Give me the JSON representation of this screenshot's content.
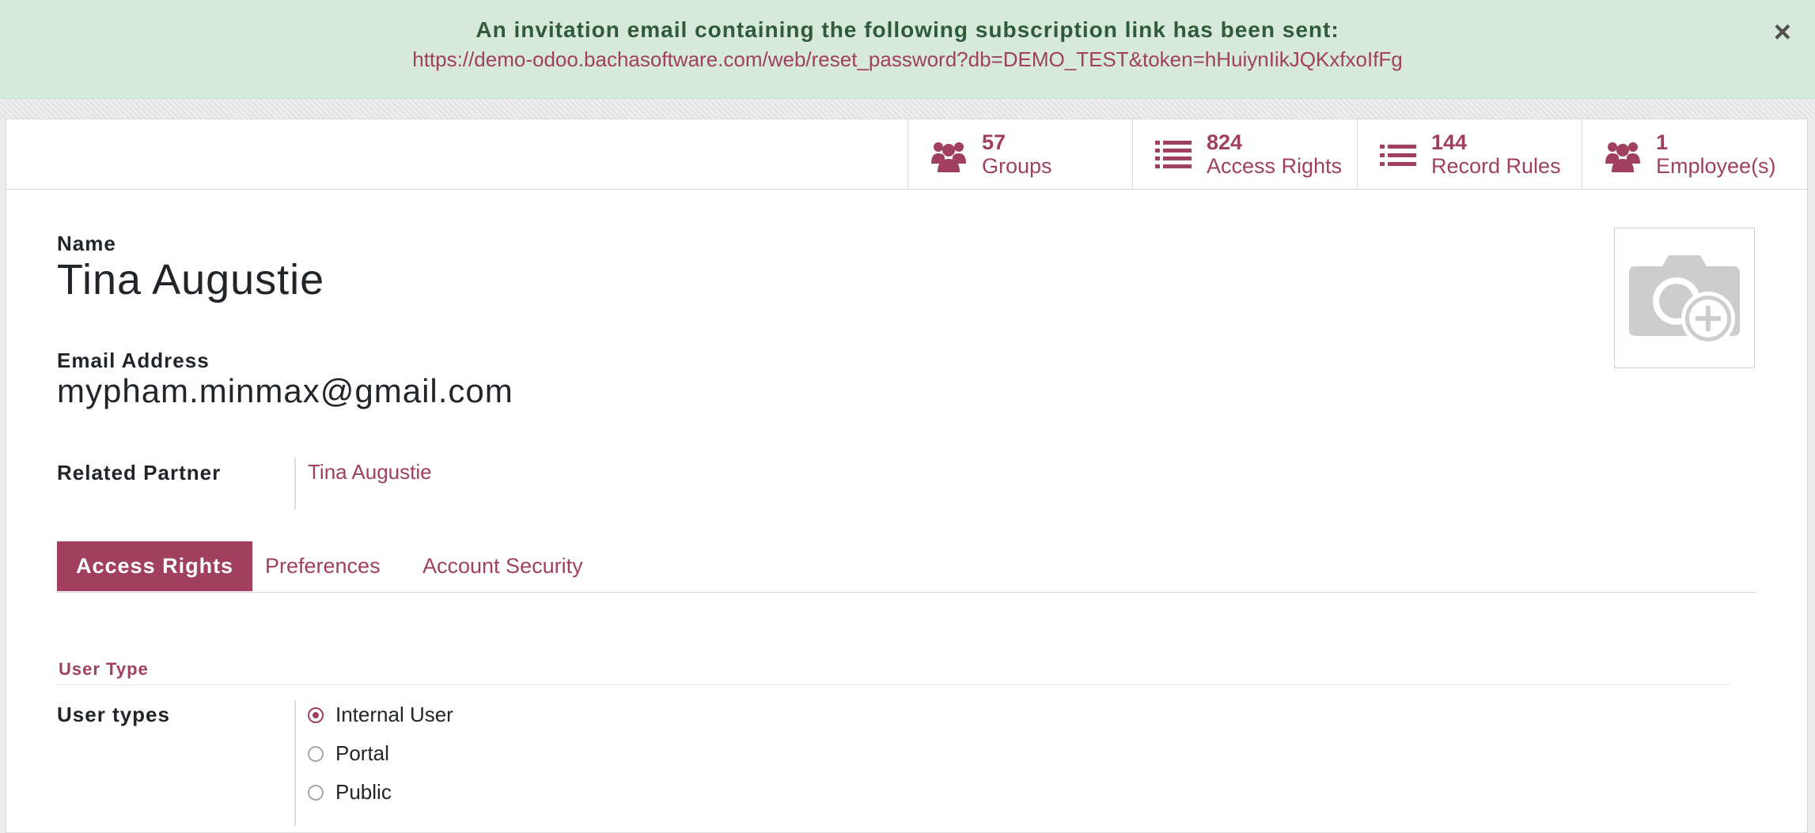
{
  "notification": {
    "message": "An invitation email containing the following subscription link has been sent:",
    "link": "https://demo-odoo.bachasoftware.com/web/reset_password?db=DEMO_TEST&token=hHuiynIikJQKxfxoIfFg",
    "close_glyph": "×"
  },
  "stat_buttons": [
    {
      "count": "57",
      "label": "Groups",
      "icon": "users-icon"
    },
    {
      "count": "824",
      "label": "Access Rights",
      "icon": "list-icon"
    },
    {
      "count": "144",
      "label": "Record Rules",
      "icon": "list-icon"
    },
    {
      "count": "1",
      "label": "Employee(s)",
      "icon": "users-icon"
    }
  ],
  "form": {
    "name_label": "Name",
    "name_value": "Tina Augustie",
    "email_label": "Email Address",
    "email_value": "mypham.minmax@gmail.com",
    "partner_label": "Related Partner",
    "partner_value": "Tina Augustie",
    "avatar_icon": "camera-plus-icon"
  },
  "tabs": [
    {
      "label": "Access Rights",
      "active": true
    },
    {
      "label": "Preferences",
      "active": false
    },
    {
      "label": "Account Security",
      "active": false
    }
  ],
  "user_type_section": {
    "title": "User Type",
    "field_label": "User types",
    "options": [
      {
        "label": "Internal User",
        "selected": true
      },
      {
        "label": "Portal",
        "selected": false
      },
      {
        "label": "Public",
        "selected": false
      }
    ]
  },
  "colors": {
    "accent": "#a0405e",
    "alert_background": "#d6e9da",
    "alert_text": "#2f5b3b"
  }
}
